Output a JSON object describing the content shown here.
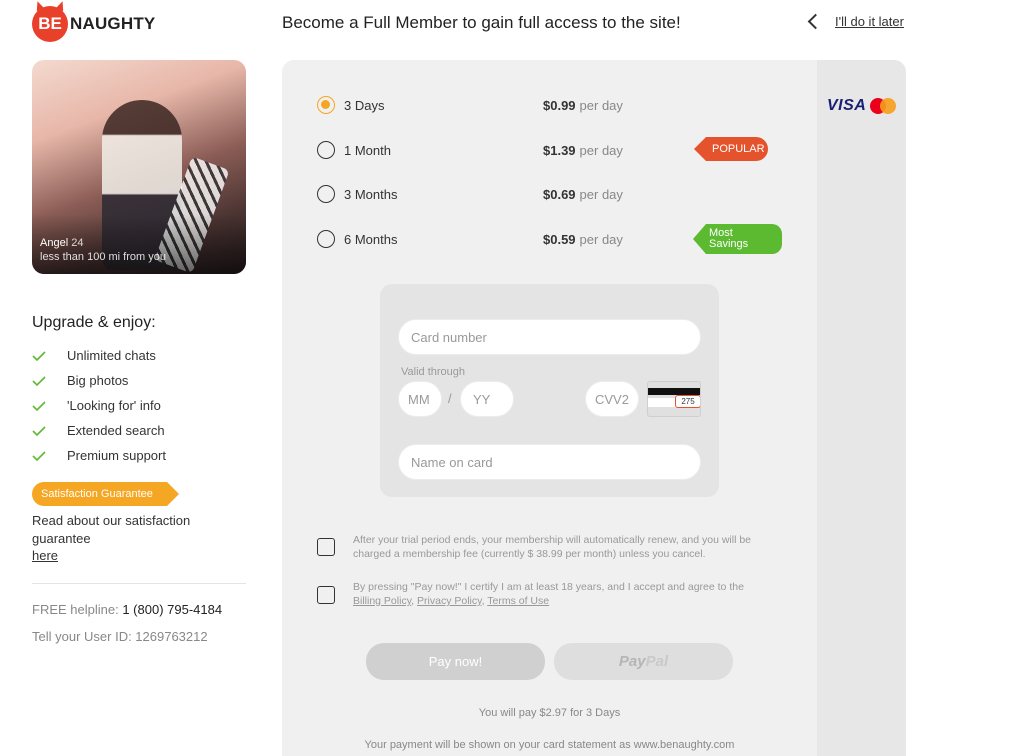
{
  "brand": {
    "be": "BE",
    "naughty": "NAUGHTY"
  },
  "header": {
    "title": "Become a Full Member to gain full access to the site!",
    "later": "I'll do it later"
  },
  "profile": {
    "name": "Angel",
    "age": "24",
    "distance": "less than 100 mi from you"
  },
  "upgrade": {
    "title": "Upgrade & enjoy:",
    "features": [
      "Unlimited chats",
      "Big photos",
      "'Looking for' info",
      "Extended search",
      "Premium support"
    ]
  },
  "satisfaction": {
    "badge": "Satisfaction Guarantee",
    "text": "Read about our satisfaction guarantee",
    "link": "here"
  },
  "helpline": {
    "label": "FREE helpline:",
    "number": "1 (800) 795-4184"
  },
  "user_id": "Tell your User ID: 1269763212",
  "payment_brands": {
    "visa": "VISA"
  },
  "plans": [
    {
      "name": "3 Days",
      "price": "$0.99",
      "per": "per day",
      "selected": true
    },
    {
      "name": "1 Month",
      "price": "$1.39",
      "per": "per day",
      "tag": "POPULAR"
    },
    {
      "name": "3 Months",
      "price": "$0.69",
      "per": "per day"
    },
    {
      "name": "6 Months",
      "price": "$0.59",
      "per": "per day",
      "tag": "Most Savings"
    }
  ],
  "tags": {
    "popular": "POPULAR",
    "savings_line1": "Most",
    "savings_line2": "Savings"
  },
  "card_form": {
    "card_number_placeholder": "Card number",
    "valid_through": "Valid through",
    "mm_placeholder": "MM",
    "slash": "/",
    "yy_placeholder": "YY",
    "cvv_placeholder": "CVV2",
    "cvv_sample": "275",
    "name_placeholder": "Name on card"
  },
  "agreements": {
    "renew": "After your trial period ends, your membership will automatically renew, and you will be charged a membership fee (currently $ 38.99 per month) unless you cancel.",
    "certify": "By pressing \"Pay now!\" I certify I am at least 18 years, and I accept and agree to the",
    "billing": "Billing Policy",
    "privacy": "Privacy Policy",
    "terms": "Terms of Use",
    "sep": ", "
  },
  "buttons": {
    "pay_now": "Pay now!",
    "paypal_pay": "Pay",
    "paypal_pal": "Pal"
  },
  "summary": {
    "pay_line": "You will pay $2.97 for 3 Days",
    "statement_line": "Your payment will be shown on your card statement as www.benaughty.com"
  },
  "colors": {
    "accent": "#f5a623",
    "popular": "#e5532d",
    "savings": "#5cba30",
    "brand_red": "#e8402a",
    "check_green": "#5cba30"
  }
}
